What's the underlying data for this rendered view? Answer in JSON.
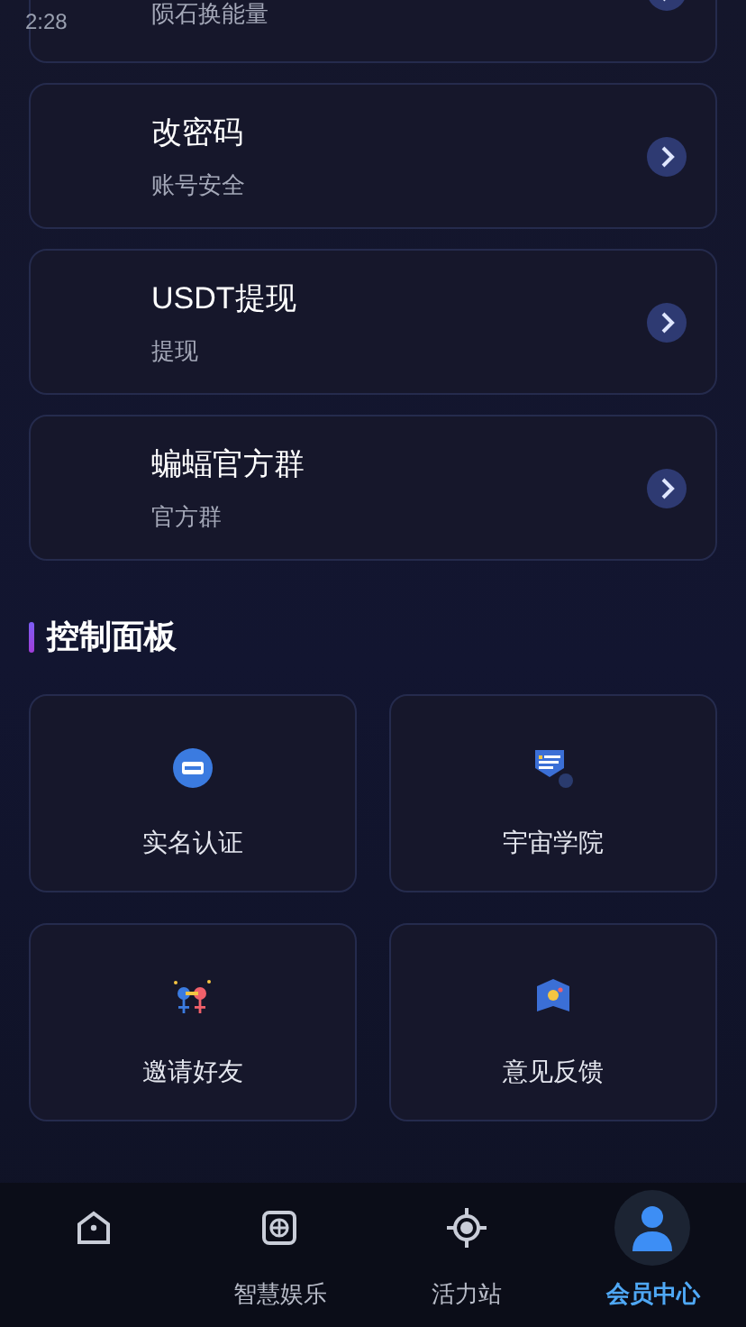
{
  "status_bar": {
    "time": "2:28"
  },
  "menu_items": [
    {
      "subtitle": "陨石换能量"
    },
    {
      "title": "改密码",
      "subtitle": "账号安全"
    },
    {
      "title": "USDT提现",
      "subtitle": "提现"
    },
    {
      "title": "蝙蝠官方群",
      "subtitle": "官方群"
    }
  ],
  "section": {
    "title": "控制面板"
  },
  "panel_items": [
    {
      "kind": "id-card",
      "label": "实名认证"
    },
    {
      "kind": "school",
      "label": "宇宙学院"
    },
    {
      "kind": "invite",
      "label": "邀请好友"
    },
    {
      "kind": "feedback",
      "label": "意见反馈"
    }
  ],
  "bottom_nav": [
    {
      "kind": "home",
      "selected": false
    },
    {
      "kind": "game",
      "label": "智慧娱乐",
      "selected": false
    },
    {
      "kind": "target",
      "label": "活力站",
      "selected": false
    },
    {
      "kind": "user",
      "label": "会员中心",
      "selected": true
    }
  ]
}
